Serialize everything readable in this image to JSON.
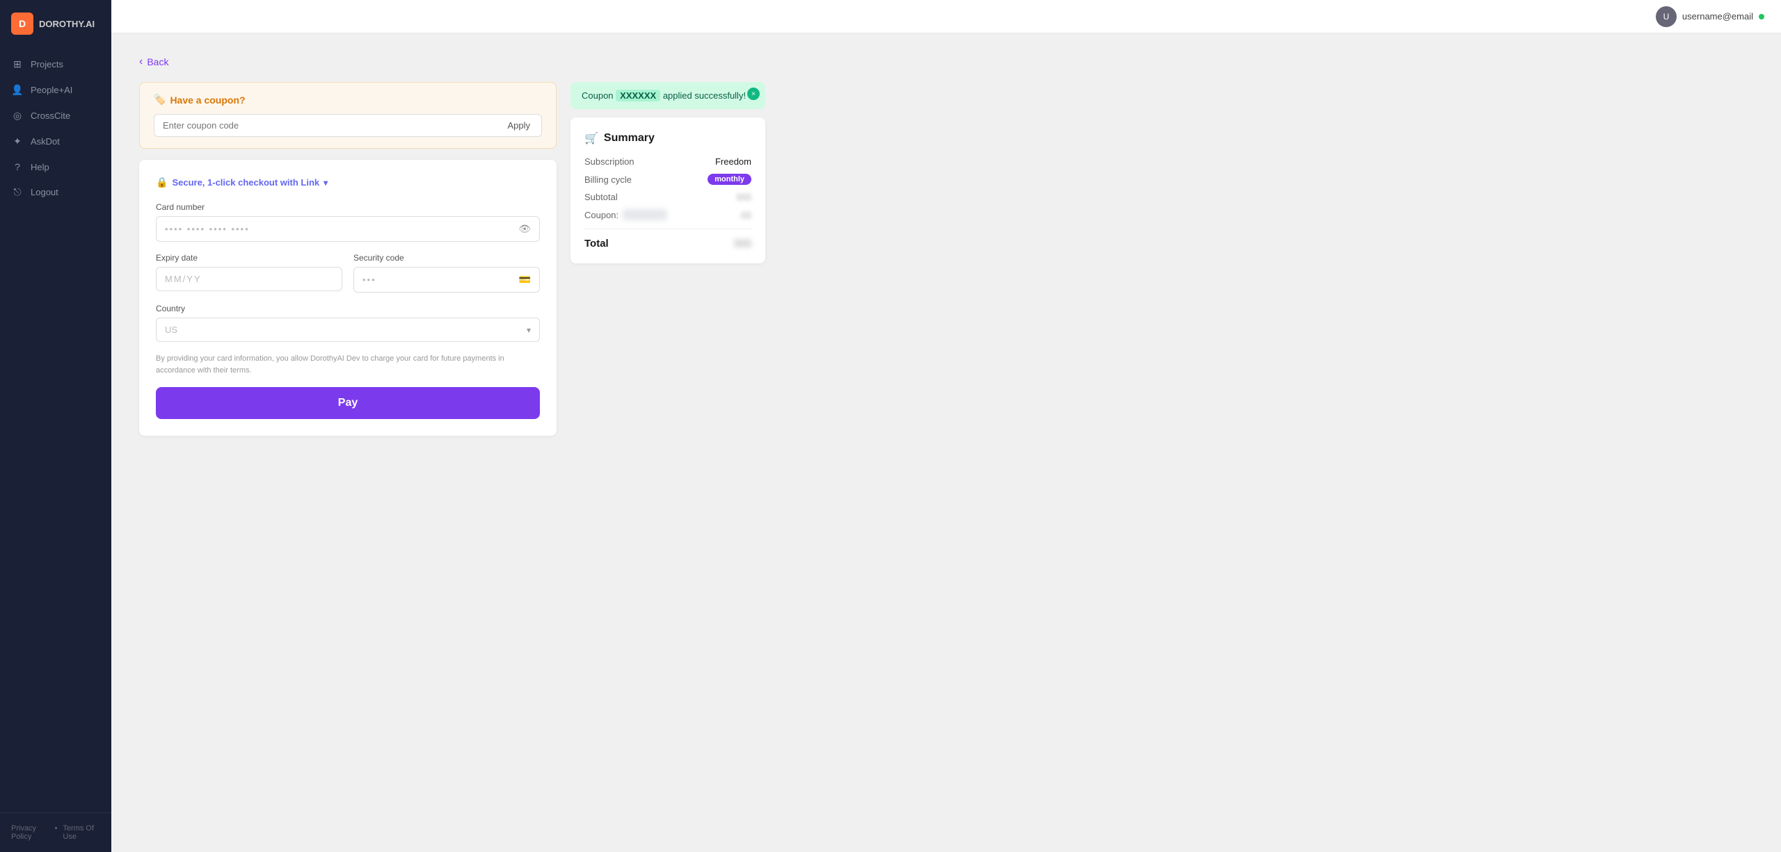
{
  "app": {
    "logo_text": "DOROTHY.AI",
    "logo_initials": "D"
  },
  "sidebar": {
    "items": [
      {
        "id": "projects",
        "label": "Projects",
        "icon": "⊞"
      },
      {
        "id": "people-ai",
        "label": "People+AI",
        "icon": "👤"
      },
      {
        "id": "crosscite",
        "label": "CrossCite",
        "icon": "◎"
      },
      {
        "id": "askdot",
        "label": "AskDot",
        "icon": "✦"
      },
      {
        "id": "help",
        "label": "Help",
        "icon": "?"
      },
      {
        "id": "logout",
        "label": "Logout",
        "icon": "⎋"
      }
    ],
    "footer": {
      "privacy_policy": "Privacy Policy",
      "separator": "•",
      "terms_of_use": "Terms Of Use"
    }
  },
  "topbar": {
    "username": "username@email",
    "status": "online"
  },
  "back_label": "Back",
  "coupon_section": {
    "title": "Have a coupon?",
    "emoji": "🏷️",
    "input_placeholder": "Enter coupon code",
    "apply_label": "Apply"
  },
  "coupon_success": {
    "message_prefix": "Coupon",
    "code": "XXXXXX",
    "message_suffix": "applied successfully!",
    "close_label": "×"
  },
  "payment": {
    "secure_label": "Secure, 1-click checkout with Link",
    "card_number_label": "Card number",
    "card_number_placeholder": "•••• •••• •••• ••••",
    "expiry_label": "Expiry date",
    "expiry_placeholder": "MM/YY",
    "security_code_label": "Security code",
    "security_code_placeholder": "•••",
    "country_label": "Country",
    "country_placeholder": "US",
    "terms_text": "By providing your card information, you allow DorothyAI Dev to charge your card for future payments in accordance with their terms.",
    "pay_label": "Pay"
  },
  "summary": {
    "title": "Summary",
    "rows": [
      {
        "label": "Subscription",
        "value": "Freedom",
        "type": "text"
      },
      {
        "label": "Billing cycle",
        "value": "monthly",
        "type": "badge"
      },
      {
        "label": "Subtotal",
        "value": "$$$",
        "type": "blurred"
      },
      {
        "label": "Coupon:",
        "coupon_name": "XXXXXX",
        "value": "-$$",
        "type": "coupon"
      }
    ],
    "total_label": "Total",
    "total_value": "$$$"
  }
}
